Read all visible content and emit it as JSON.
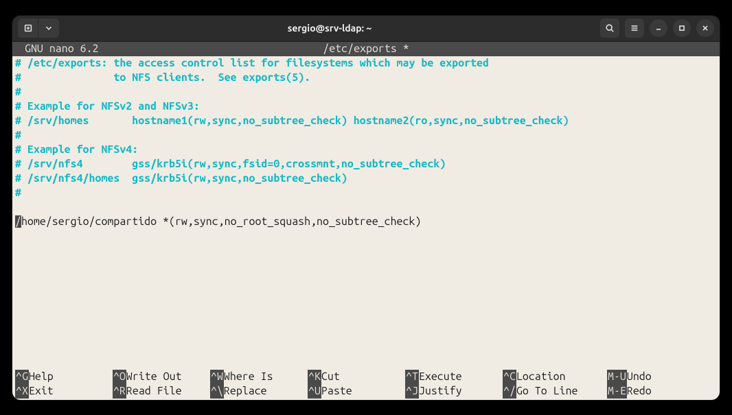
{
  "window": {
    "title": "sergio@srv-ldap: ~"
  },
  "nano": {
    "app_name": "GNU nano 6.2",
    "filename": "/etc/exports *"
  },
  "editor": {
    "lines": [
      "# /etc/exports: the access control list for filesystems which may be exported",
      "#               to NFS clients.  See exports(5).",
      "#",
      "# Example for NFSv2 and NFSv3:",
      "# /srv/homes       hostname1(rw,sync,no_subtree_check) hostname2(ro,sync,no_subtree_check)",
      "#",
      "# Example for NFSv4:",
      "# /srv/nfs4        gss/krb5i(rw,sync,fsid=0,crossmnt,no_subtree_check)",
      "# /srv/nfs4/homes  gss/krb5i(rw,sync,no_subtree_check)",
      "#"
    ],
    "active_line_cursor": "/",
    "active_line_rest": "home/sergio/compartido *(rw,sync,no_root_squash,no_subtree_check)"
  },
  "shortcuts": {
    "row1": [
      {
        "key": "^G",
        "label": " Help"
      },
      {
        "key": "^O",
        "label": " Write Out"
      },
      {
        "key": "^W",
        "label": " Where Is"
      },
      {
        "key": "^K",
        "label": " Cut"
      },
      {
        "key": "^T",
        "label": " Execute"
      },
      {
        "key": "^C",
        "label": " Location"
      },
      {
        "key": "M-U",
        "label": " Undo"
      }
    ],
    "row2": [
      {
        "key": "^X",
        "label": " Exit"
      },
      {
        "key": "^R",
        "label": " Read File"
      },
      {
        "key": "^\\",
        "label": " Replace"
      },
      {
        "key": "^U",
        "label": " Paste"
      },
      {
        "key": "^J",
        "label": " Justify"
      },
      {
        "key": "^/",
        "label": " Go To Line"
      },
      {
        "key": "M-E",
        "label": " Redo"
      }
    ]
  }
}
